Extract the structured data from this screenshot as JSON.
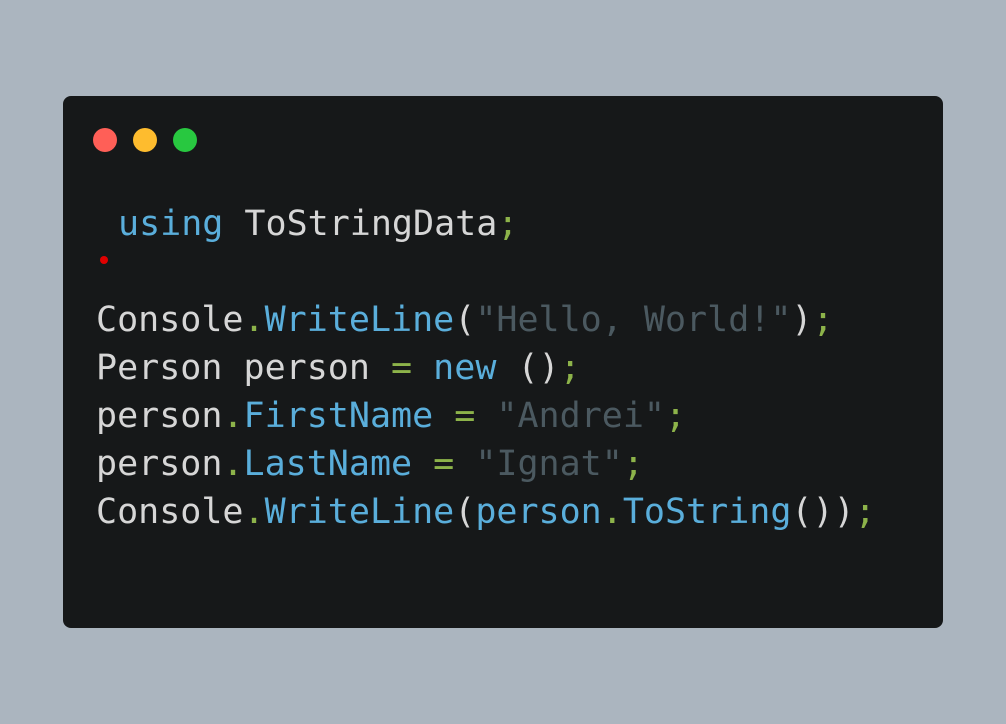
{
  "colors": {
    "background": "#abb5bf",
    "window_background": "#161819",
    "dot_close": "#ff5f57",
    "dot_minimize": "#febc2e",
    "dot_maximize": "#28c840",
    "breakpoint": "#e00000",
    "keyword": "#5aaedb",
    "punctuation": "#8db34a",
    "string": "#4b5960",
    "identifier": "#d6d6d6"
  },
  "window": {
    "controls": [
      {
        "icon": "close-dot-icon"
      },
      {
        "icon": "minimize-dot-icon"
      },
      {
        "icon": "maximize-dot-icon"
      }
    ]
  },
  "code": {
    "lines": [
      [
        {
          "text": "using",
          "kind": "kw"
        },
        {
          "text": " ToStringData",
          "kind": "ident"
        },
        {
          "text": ";",
          "kind": "punct"
        }
      ],
      [],
      [
        {
          "text": "Console",
          "kind": "ident"
        },
        {
          "text": ".",
          "kind": "punct"
        },
        {
          "text": "WriteLine",
          "kind": "member"
        },
        {
          "text": "(",
          "kind": "paren"
        },
        {
          "text": "\"Hello, World!\"",
          "kind": "str"
        },
        {
          "text": ")",
          "kind": "paren"
        },
        {
          "text": ";",
          "kind": "punct"
        }
      ],
      [
        {
          "text": "Person person ",
          "kind": "ident"
        },
        {
          "text": "=",
          "kind": "punct"
        },
        {
          "text": " ",
          "kind": "ident"
        },
        {
          "text": "new",
          "kind": "kw"
        },
        {
          "text": " ()",
          "kind": "paren"
        },
        {
          "text": ";",
          "kind": "punct"
        }
      ],
      [
        {
          "text": "person",
          "kind": "ident"
        },
        {
          "text": ".",
          "kind": "punct"
        },
        {
          "text": "FirstName",
          "kind": "member"
        },
        {
          "text": " ",
          "kind": "ident"
        },
        {
          "text": "=",
          "kind": "punct"
        },
        {
          "text": " ",
          "kind": "ident"
        },
        {
          "text": "\"Andrei\"",
          "kind": "str"
        },
        {
          "text": ";",
          "kind": "punct"
        }
      ],
      [
        {
          "text": "person",
          "kind": "ident"
        },
        {
          "text": ".",
          "kind": "punct"
        },
        {
          "text": "LastName",
          "kind": "member"
        },
        {
          "text": " ",
          "kind": "ident"
        },
        {
          "text": "=",
          "kind": "punct"
        },
        {
          "text": " ",
          "kind": "ident"
        },
        {
          "text": "\"Ignat\"",
          "kind": "str"
        },
        {
          "text": ";",
          "kind": "punct"
        }
      ],
      [
        {
          "text": "Console",
          "kind": "ident"
        },
        {
          "text": ".",
          "kind": "punct"
        },
        {
          "text": "WriteLine",
          "kind": "member"
        },
        {
          "text": "(",
          "kind": "paren"
        },
        {
          "text": "person",
          "kind": "member"
        },
        {
          "text": ".",
          "kind": "punct"
        },
        {
          "text": "ToString",
          "kind": "member"
        },
        {
          "text": "())",
          "kind": "paren"
        },
        {
          "text": ";",
          "kind": "punct"
        }
      ]
    ]
  }
}
